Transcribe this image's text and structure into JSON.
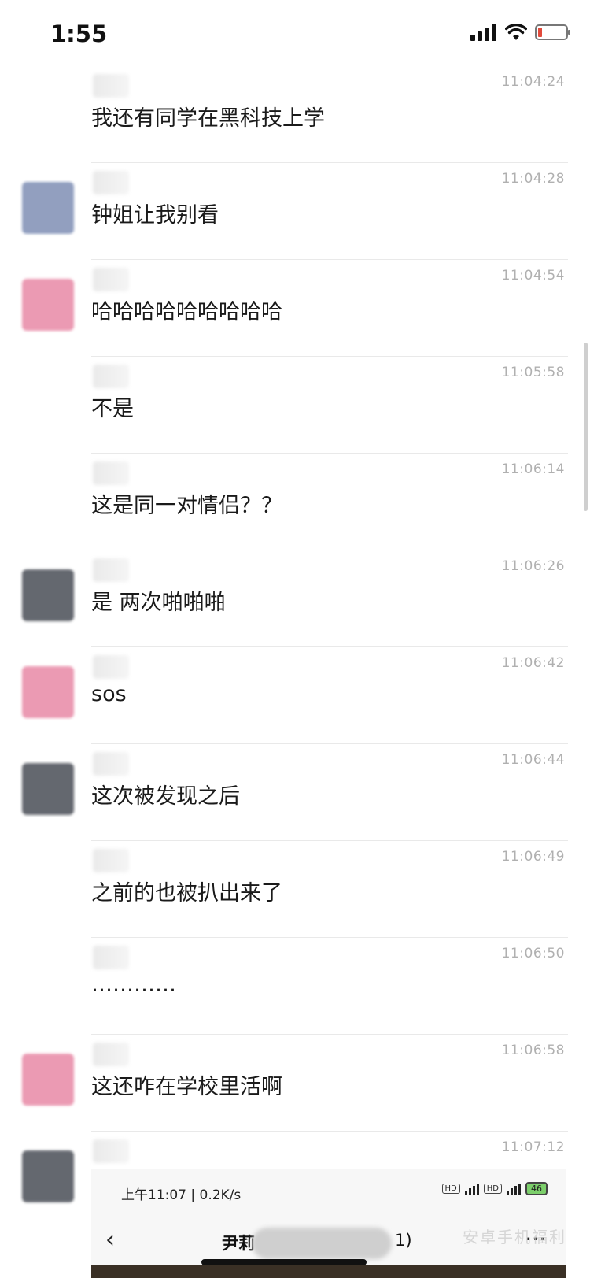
{
  "status_bar": {
    "time": "1:55"
  },
  "messages": [
    {
      "time": "11:04:24",
      "text": "我还有同学在黑科技上学",
      "avatar": false
    },
    {
      "time": "11:04:28",
      "text": "钟姐让我别看",
      "avatar": true,
      "avatar_color": "#7f8fb5"
    },
    {
      "time": "11:04:54",
      "text": "哈哈哈哈哈哈哈哈哈",
      "avatar": true,
      "avatar_color": "#e889a6"
    },
    {
      "time": "11:05:58",
      "text": "不是",
      "avatar": false
    },
    {
      "time": "11:06:14",
      "text": "这是同一对情侣？？",
      "avatar": false
    },
    {
      "time": "11:06:26",
      "text": "是 两次啪啪啪",
      "avatar": true,
      "avatar_color": "#4a4e57"
    },
    {
      "time": "11:06:42",
      "text": "sos",
      "avatar": true,
      "avatar_color": "#e889a6"
    },
    {
      "time": "11:06:44",
      "text": "这次被发现之后",
      "avatar": true,
      "avatar_color": "#4a4e57"
    },
    {
      "time": "11:06:49",
      "text": "之前的也被扒出来了",
      "avatar": false
    },
    {
      "time": "11:06:50",
      "text": "…………",
      "avatar": false
    },
    {
      "time": "11:06:58",
      "text": "这还咋在学校里活啊",
      "avatar": true,
      "avatar_color": "#e889a6"
    },
    {
      "time": "11:07:12",
      "text": "",
      "avatar": true,
      "avatar_color": "#4a4e57"
    }
  ],
  "embedded": {
    "status_left": "上午11:07 | 0.2K/s",
    "battery": "46",
    "back_glyph": "‹",
    "title_visible": "尹莉",
    "title_suffix": "1)",
    "more_glyph": "···"
  },
  "watermark": "安卓手机福利"
}
